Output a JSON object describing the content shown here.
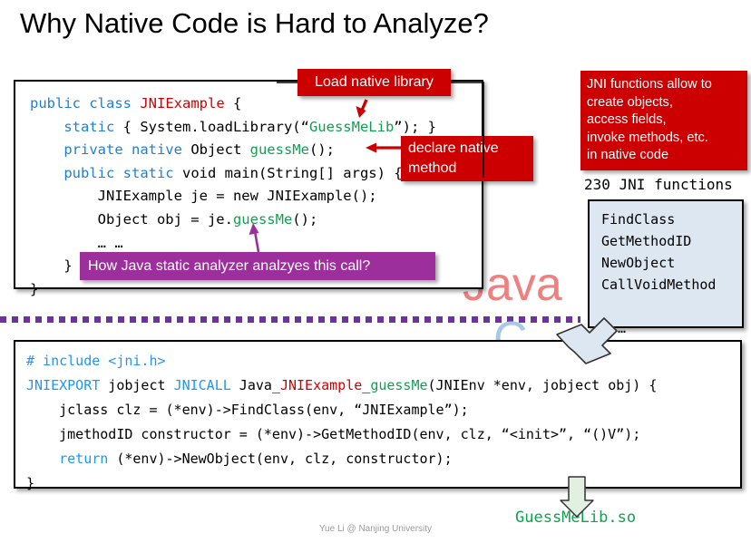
{
  "slide": {
    "title": "Why Native Code is Hard to Analyze?",
    "footer": "Yue Li @ Nanjing University"
  },
  "java_block": {
    "language_label": "Java",
    "line1_kw1": "public class ",
    "line1_class": "JNIExample",
    "line1_rest": " {",
    "line2_kw": "static",
    "line2_mid": " { System.loadLibrary(“",
    "line2_str": "GuessMeLib",
    "line2_end": "”); }",
    "line3_kw": "private native",
    "line3_mid": " Object ",
    "line3_m": "guessMe",
    "line3_end": "();",
    "line4_kw": "public static",
    "line4_rest": " void main(String[] args) {",
    "line5": "JNIExample je = new JNIExample();",
    "line6_pre": "Object obj = je.",
    "line6_m": "guessMe",
    "line6_end": "();",
    "line7": "… …",
    "line8": "}",
    "line9": "}"
  },
  "c_block": {
    "language_label": "C",
    "line1": "# include <jni.h>",
    "line2_a": "JNIEXPORT",
    "line2_b": " jobject ",
    "line2_c": "JNICALL",
    "line2_d": " Java_",
    "line2_e": "JNIExample",
    "line2_f": "_",
    "line2_g": "guessMe",
    "line2_h": "(JNIEnv *env, jobject obj) {",
    "line3": "jclass clz = (*env)->FindClass(env, “JNIExample”);",
    "line4": "jmethodID constructor = (*env)->GetMethodID(env, clz, “<init>”, “()V”);",
    "line5_kw": "return",
    "line5_rest": " (*env)->NewObject(env, clz, constructor);",
    "line6": "}"
  },
  "callouts": {
    "load_library": "Load native library",
    "declare_native": "declare native\nmethod",
    "jni_allow": "JNI functions allow to\ncreate objects,\naccess fields,\ninvoke methods, etc.\nin native code",
    "analyzer_question": "How Java static analyzer analzyes this call?"
  },
  "jni_panel": {
    "count_label": "230 JNI functions",
    "functions": "FindClass\nGetMethodID\nNewObject\nCallVoidMethod\n\n… …"
  },
  "output": {
    "library_name": "GuessMeLib.so"
  },
  "colors": {
    "red_callout": "#cc0000",
    "purple_callout": "#9c2f9c",
    "divider_purple": "#7030a0",
    "java_label": "#f08080",
    "c_label": "#a6c9e8",
    "panel_blue": "#dde7f2",
    "code_green": "#12a050",
    "code_blue": "#1f7fd4",
    "code_red": "#d00000",
    "footer_gray": "#9a9a9a"
  }
}
